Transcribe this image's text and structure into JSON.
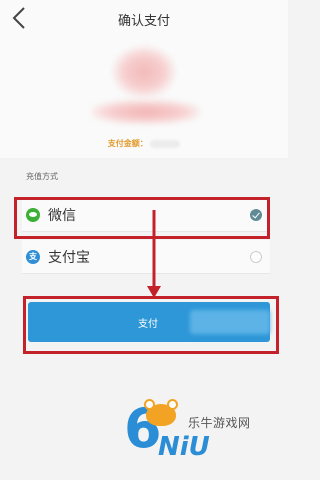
{
  "header": {
    "back_icon": "chevron-left-icon",
    "title": "确认支付"
  },
  "merchant": {
    "amount_label": "支付金额："
  },
  "payment_methods": {
    "header": "充值方式",
    "options": [
      {
        "label": "微信",
        "icon": "wechat-icon",
        "selected": true
      },
      {
        "label": "支付宝",
        "icon": "alipay-icon",
        "selected": false
      }
    ]
  },
  "pay_button": {
    "label": "支付"
  },
  "annotation": {
    "color": "#c4222b"
  },
  "watermark": {
    "brand_number": "6",
    "brand_latin": "NiU",
    "site_name": "乐牛游戏网"
  },
  "colors": {
    "pay_button": "#2d97d8",
    "wechat": "#3cb034",
    "alipay": "#2f8ed6",
    "amount_label": "#e39b2d"
  }
}
